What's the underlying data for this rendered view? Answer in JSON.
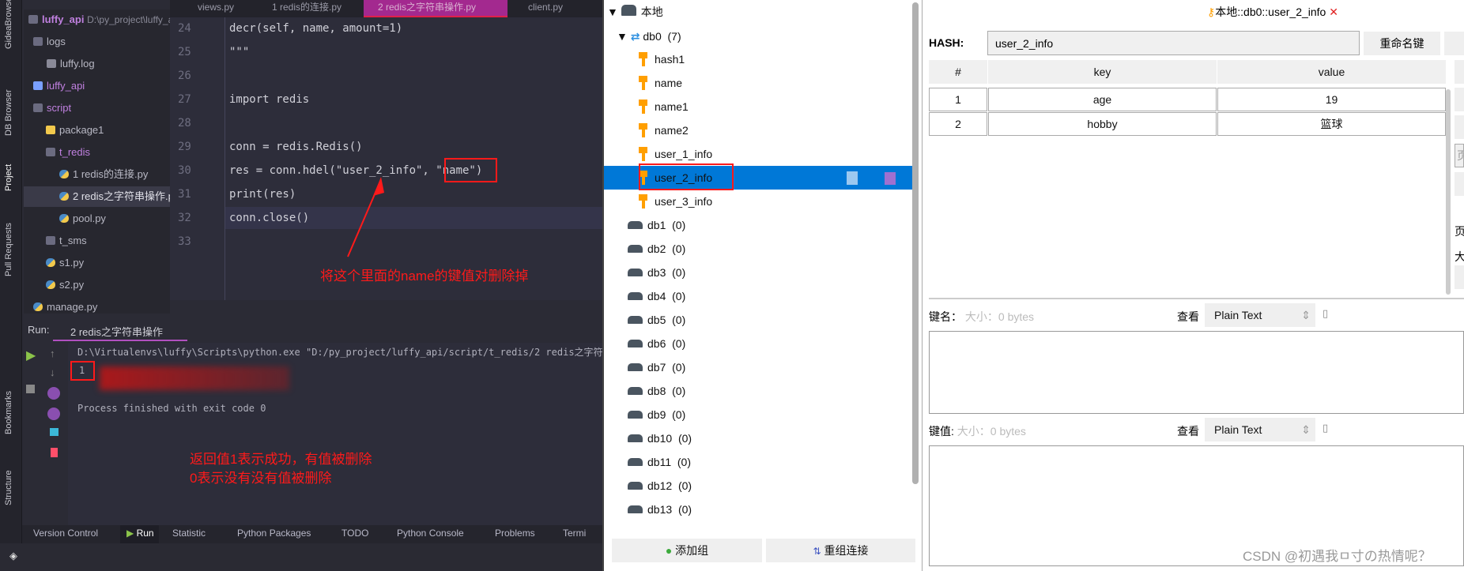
{
  "ide": {
    "tool_stripe": [
      "GideaBrowser",
      "DB Browser",
      "Project",
      "Pull Requests",
      "Bookmarks",
      "Structure"
    ],
    "project": {
      "root_name": "luffy_api",
      "root_path": "D:\\py_project\\luffy_a",
      "items": [
        "logs",
        "luffy.log",
        "luffy_api",
        "script",
        "package1",
        "t_redis",
        "1 redis的连接.py",
        "2 redis之字符串操作.py",
        "pool.py",
        "t_sms",
        "s1.py",
        "s2.py",
        "manage.py"
      ]
    },
    "editor_tabs": [
      "views.py",
      "1 redis的连接.py",
      "2 redis之字符串操作.py",
      "client.py"
    ],
    "active_tab": 2,
    "lines": [
      {
        "n": "24",
        "code": "decr(self, name, amount=1)"
      },
      {
        "n": "25",
        "code": "\"\"\""
      },
      {
        "n": "26",
        "code": ""
      },
      {
        "n": "27",
        "code": "import redis"
      },
      {
        "n": "28",
        "code": ""
      },
      {
        "n": "29",
        "code": "conn = redis.Redis()"
      },
      {
        "n": "30",
        "code": "res = conn.hdel(\"user_2_info\", \"name\")"
      },
      {
        "n": "31",
        "code": "print(res)"
      },
      {
        "n": "32",
        "code": "conn.close()"
      },
      {
        "n": "33",
        "code": ""
      }
    ],
    "annotation_code": "将这个里面的name的键值对删除掉",
    "run": {
      "label": "Run:",
      "tab": "2 redis之字符串操作",
      "command": "D:\\Virtualenvs\\luffy\\Scripts\\python.exe \"D:/py_project/luffy_api/script/t_redis/2 redis之字符串操",
      "output": "1",
      "finished": "Process finished with exit code 0"
    },
    "annotation_run": [
      "返回值1表示成功，有值被删除",
      "0表示没有没有值被删除"
    ],
    "bottom_tools": [
      "Version Control",
      "Run",
      "Statistic",
      "Python Packages",
      "TODO",
      "Python Console",
      "Problems",
      "Termi"
    ]
  },
  "tree": {
    "connection": "本地",
    "db0": {
      "name": "db0",
      "count": "(7)",
      "keys": [
        "hash1",
        "name",
        "name1",
        "name2",
        "user_1_info",
        "user_2_info",
        "user_3_info"
      ],
      "selected": "user_2_info"
    },
    "dbs": [
      {
        "name": "db1",
        "count": "(0)"
      },
      {
        "name": "db2",
        "count": "(0)"
      },
      {
        "name": "db3",
        "count": "(0)"
      },
      {
        "name": "db4",
        "count": "(0)"
      },
      {
        "name": "db5",
        "count": "(0)"
      },
      {
        "name": "db6",
        "count": "(0)"
      },
      {
        "name": "db7",
        "count": "(0)"
      },
      {
        "name": "db8",
        "count": "(0)"
      },
      {
        "name": "db9",
        "count": "(0)"
      },
      {
        "name": "db10",
        "count": "(0)"
      },
      {
        "name": "db11",
        "count": "(0)"
      },
      {
        "name": "db12",
        "count": "(0)"
      },
      {
        "name": "db13",
        "count": "(0)"
      }
    ],
    "add_group": "添加组",
    "reconnect": "重组连接"
  },
  "detail": {
    "tab_title": "本地::db0::user_2_info",
    "type_label": "HASH:",
    "key_name": "user_2_info",
    "rename": "重命名键",
    "columns": [
      "#",
      "key",
      "value"
    ],
    "rows": [
      [
        "1",
        "age",
        "19"
      ],
      [
        "2",
        "hobby",
        "篮球"
      ]
    ],
    "side_labels": [
      "页",
      "页:",
      "大"
    ],
    "key_label": "键名：",
    "key_size": "大小：0 bytes",
    "value_label": "键值:",
    "value_size": "大小：0 bytes",
    "view_label": "查看",
    "view_mode": "Plain Text"
  },
  "watermark": "CSDN @初遇我ㅁ寸の热情呢？",
  "colors": {
    "accent": "#0078d7",
    "annotation": "#ff1a1a",
    "active_tab": "#a3298f",
    "key_icon": "#ff9f00"
  }
}
